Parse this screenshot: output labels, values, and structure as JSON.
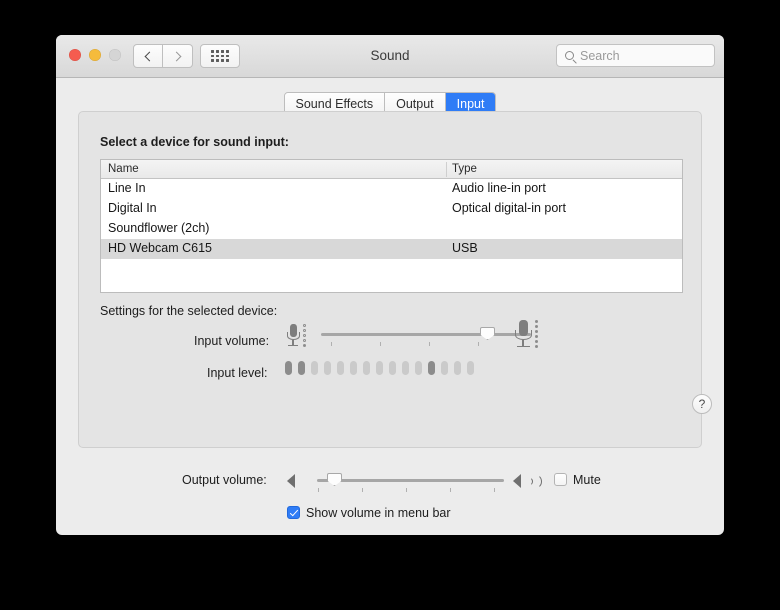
{
  "window": {
    "title": "Sound",
    "traffic_lights": [
      "close-red",
      "minimize-yellow",
      "zoom-disabled"
    ],
    "nav": {
      "back": "back-chevron",
      "forward": "forward-chevron",
      "show_all": "grid-icon"
    },
    "search": {
      "placeholder": "Search",
      "value": "",
      "icon": "search-icon"
    }
  },
  "tabs": [
    {
      "label": "Sound Effects",
      "active": false
    },
    {
      "label": "Output",
      "active": false
    },
    {
      "label": "Input",
      "active": true
    }
  ],
  "main": {
    "device_section_label": "Select a device for sound input:",
    "table": {
      "columns": [
        "Name",
        "Type"
      ],
      "rows": [
        {
          "name": "Line In",
          "type": "Audio line-in port",
          "selected": false
        },
        {
          "name": "Digital In",
          "type": "Optical digital-in port",
          "selected": false
        },
        {
          "name": "Soundflower (2ch)",
          "type": "",
          "selected": false
        },
        {
          "name": "HD Webcam C615",
          "type": "USB",
          "selected": true
        }
      ]
    },
    "settings_label": "Settings for the selected device:",
    "input_volume": {
      "label": "Input volume:",
      "value_percent": 86,
      "left_icon": "microphone-quiet-icon",
      "right_icon": "microphone-loud-icon",
      "ticks": 4
    },
    "input_level": {
      "label": "Input level:",
      "segments": 15,
      "active_indices": [
        0,
        1,
        11
      ]
    },
    "help_button": "?"
  },
  "footer": {
    "output_volume": {
      "label": "Output volume:",
      "value_percent": 12,
      "left_icon": "speaker-icon",
      "right_icon": "speaker-waves-icon",
      "ticks": 5
    },
    "mute": {
      "label": "Mute",
      "checked": false
    },
    "show_volume_menu_bar": {
      "label": "Show volume in menu bar",
      "checked": true
    }
  },
  "colors": {
    "accent": "#2f7cf6",
    "window_bg": "#ececec",
    "panel_bg": "#e4e4e4",
    "selected_row": "#d8d8d8"
  }
}
